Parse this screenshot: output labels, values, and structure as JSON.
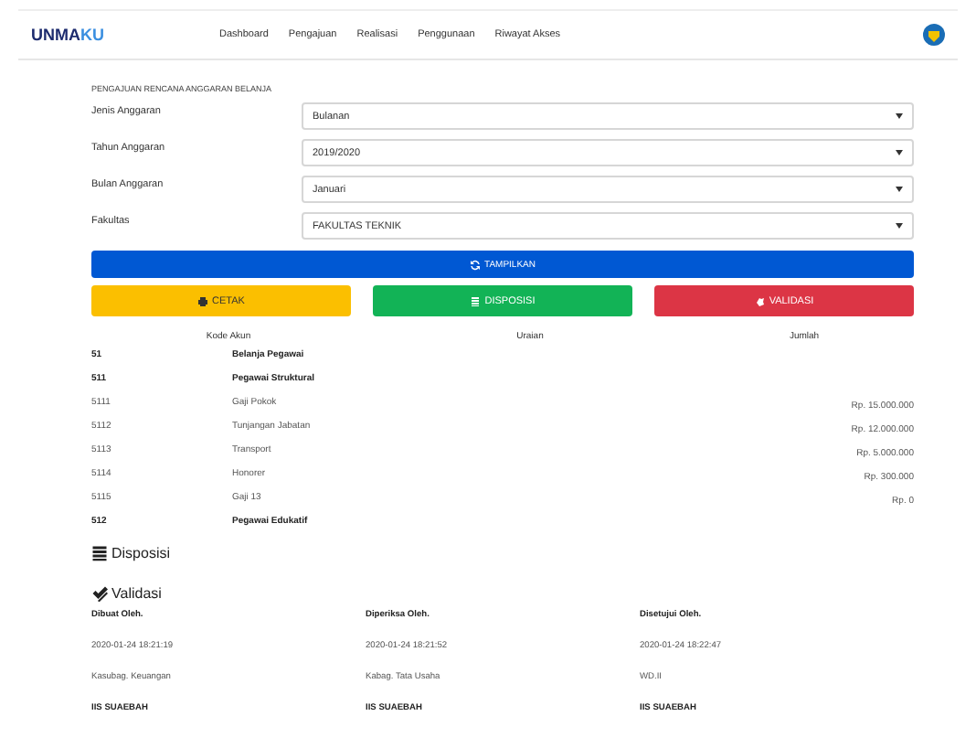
{
  "navbar": {
    "brand_dark": "UNMA",
    "brand_light": "KU",
    "links": [
      {
        "label": "Dashboard"
      },
      {
        "label": "Pengajuan"
      },
      {
        "label": "Realisasi"
      },
      {
        "label": "Penggunaan"
      },
      {
        "label": "Riwayat Akses"
      }
    ]
  },
  "form": {
    "title": "PENGAJUAN RENCANA ANGGARAN BELANJA",
    "fields": [
      {
        "label": "Jenis Anggaran",
        "value": "Bulanan"
      },
      {
        "label": "Tahun Anggaran",
        "value": "2019/2020"
      },
      {
        "label": "Bulan Anggaran",
        "value": "Januari"
      },
      {
        "label": "Fakultas",
        "value": "FAKULTAS TEKNIK"
      }
    ],
    "submit": "TAMPILKAN"
  },
  "actions": [
    {
      "label": "CETAK",
      "kind": "print"
    },
    {
      "label": "DISPOSISI",
      "kind": "disposition"
    },
    {
      "label": "VALIDASI",
      "kind": "validate"
    }
  ],
  "table": {
    "columns": [
      "Kode Akun",
      "Uraian",
      "Jumlah"
    ],
    "rows": [
      {
        "kind": "group",
        "code": "51",
        "name": "Belanja Pegawai"
      },
      {
        "kind": "group",
        "code": "511",
        "name": "Pegawai Struktural"
      },
      {
        "kind": "item",
        "code": "5111",
        "name": "Gaji Pokok",
        "amount": "Rp. 15.000.000"
      },
      {
        "kind": "item",
        "code": "5112",
        "name": "Tunjangan Jabatan",
        "amount": "Rp. 12.000.000"
      },
      {
        "kind": "item",
        "code": "5113",
        "name": "Transport",
        "amount": "Rp. 5.000.000"
      },
      {
        "kind": "item",
        "code": "5114",
        "name": "Honorer",
        "amount": "Rp. 300.000"
      },
      {
        "kind": "item",
        "code": "5115",
        "name": "Gaji 13",
        "amount": "Rp. 0"
      },
      {
        "kind": "group",
        "code": "512",
        "name": "Pegawai Edukatif"
      }
    ]
  },
  "disposisi": {
    "title": "Disposisi"
  },
  "validasi": {
    "title": "Validasi",
    "signers": [
      {
        "heading": "Dibuat Oleh.",
        "time": "2020-01-24 18:21:19",
        "role": "Kasubag. Keuangan",
        "name": "IIS SUAEBAH"
      },
      {
        "heading": "Diperiksa Oleh.",
        "time": "2020-01-24 18:21:52",
        "role": "Kabag. Tata Usaha",
        "name": "IIS SUAEBAH"
      },
      {
        "heading": "Disetujui Oleh.",
        "time": "2020-01-24 18:22:47",
        "role": "WD.II",
        "name": "IIS SUAEBAH"
      }
    ]
  }
}
